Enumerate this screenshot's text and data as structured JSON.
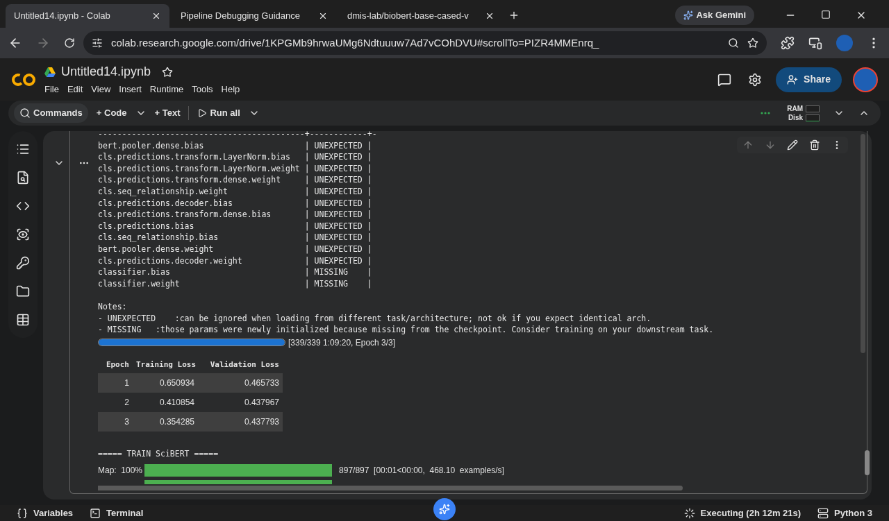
{
  "browser": {
    "tabs": [
      {
        "title": "Untitled14.ipynb - Colab",
        "selected": true
      },
      {
        "title": "Pipeline Debugging Guidance",
        "selected": false
      },
      {
        "title": "dmis-lab/biobert-base-cased-v",
        "selected": false
      }
    ],
    "gemini_button": "Ask Gemini",
    "url": "colab.research.google.com/drive/1KPGMb9hrwaUMg6Ndtuuuw7Ad7vCOhDVU#scrollTo=PIZR4MMEnrq_"
  },
  "notebook": {
    "title": "Untitled14.ipynb",
    "menu": [
      "File",
      "Edit",
      "View",
      "Insert",
      "Runtime",
      "Tools",
      "Help"
    ],
    "share": "Share"
  },
  "toolbar": {
    "commands": "Commands",
    "code": "+ Code",
    "text": "+ Text",
    "run_all": "Run all",
    "ram": "RAM",
    "disk": "Disk"
  },
  "output": {
    "lines": [
      "-------------------------------------------+------------+-",
      "bert.pooler.dense.bias                     | UNEXPECTED |",
      "cls.predictions.transform.LayerNorm.bias   | UNEXPECTED |",
      "cls.predictions.transform.LayerNorm.weight | UNEXPECTED |",
      "cls.predictions.transform.dense.weight     | UNEXPECTED |",
      "cls.seq_relationship.weight                | UNEXPECTED |",
      "cls.predictions.decoder.bias               | UNEXPECTED |",
      "cls.predictions.transform.dense.bias       | UNEXPECTED |",
      "cls.predictions.bias                       | UNEXPECTED |",
      "cls.seq_relationship.bias                  | UNEXPECTED |",
      "bert.pooler.dense.weight                   | UNEXPECTED |",
      "cls.predictions.decoder.weight             | UNEXPECTED |",
      "classifier.bias                            | MISSING    |",
      "classifier.weight                          | MISSING    |"
    ],
    "notes": [
      "Notes:",
      "- UNEXPECTED    :can be ignored when loading from different task/architecture; not ok if you expect identical arch.",
      "- MISSING   :those params were newly initialized because missing from the checkpoint. Consider training on your downstream task."
    ],
    "training_progress": {
      "level": 1,
      "reading": "[339/339 1:09:20, Epoch 3/3]"
    },
    "table": {
      "columns": [
        "Epoch",
        "Training Loss",
        "Validation Loss"
      ],
      "rows": [
        [
          "1",
          "0.650934",
          "0.465733"
        ],
        [
          "2",
          "0.410854",
          "0.437967"
        ],
        [
          "3",
          "0.354285",
          "0.437793"
        ]
      ]
    },
    "section_title": "===== TRAIN SciBERT =====",
    "map_progress": [
      {
        "label": "Map:  100%",
        "level": 1,
        "reading": "897/897  [00:01<00:00,  468.10  examples/s]"
      }
    ]
  },
  "status_bar": {
    "variables": "Variables",
    "terminal": "Terminal",
    "executing": "Executing (2h 12m 21s)",
    "runtime": "Python 3"
  }
}
